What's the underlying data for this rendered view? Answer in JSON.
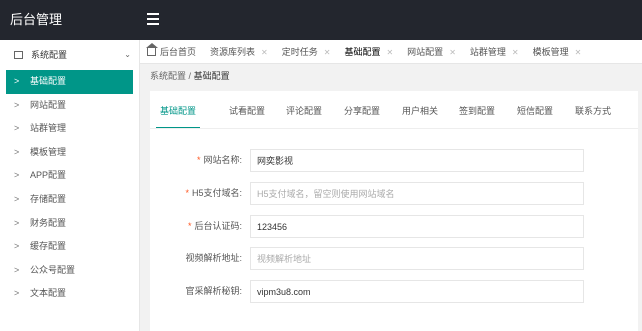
{
  "app": {
    "title": "后台管理"
  },
  "sidebar": {
    "group_label": "系统配置",
    "items": [
      {
        "label": "基础配置",
        "active": true
      },
      {
        "label": "网站配置"
      },
      {
        "label": "站群管理"
      },
      {
        "label": "模板管理"
      },
      {
        "label": "APP配置"
      },
      {
        "label": "存储配置"
      },
      {
        "label": "财务配置"
      },
      {
        "label": "缓存配置"
      },
      {
        "label": "公众号配置"
      },
      {
        "label": "文本配置"
      }
    ]
  },
  "tabs": [
    {
      "label": "后台首页",
      "closable": false
    },
    {
      "label": "资源库列表",
      "closable": true
    },
    {
      "label": "定时任务",
      "closable": true
    },
    {
      "label": "基础配置",
      "closable": true,
      "active": true
    },
    {
      "label": "网站配置",
      "closable": true
    },
    {
      "label": "站群管理",
      "closable": true
    },
    {
      "label": "模板管理",
      "closable": true
    }
  ],
  "breadcrumb": {
    "parent": "系统配置",
    "separator": "/",
    "current": "基础配置"
  },
  "subtabs": [
    {
      "label": "基础配置",
      "active": true
    },
    {
      "label": "试看配置"
    },
    {
      "label": "评论配置"
    },
    {
      "label": "分享配置"
    },
    {
      "label": "用户相关"
    },
    {
      "label": "签到配置"
    },
    {
      "label": "短信配置"
    },
    {
      "label": "联系方式"
    }
  ],
  "form": [
    {
      "label": "网站名称:",
      "required": true,
      "value": "网奕影视",
      "placeholder": ""
    },
    {
      "label": "H5支付域名:",
      "required": true,
      "value": "",
      "placeholder": "H5支付域名，留空则使用网站域名"
    },
    {
      "label": "后台认证码:",
      "required": true,
      "value": "123456",
      "placeholder": ""
    },
    {
      "label": "视频解析地址:",
      "required": false,
      "value": "",
      "placeholder": "视频解析地址"
    },
    {
      "label": "官采解析秘钥:",
      "required": false,
      "value": "vipm3u8.com",
      "placeholder": ""
    }
  ],
  "colors": {
    "accent": "#009688",
    "topbar": "#23262e",
    "required": "#ff5722"
  },
  "icons": {
    "menu": "hamburger-icon",
    "home": "home-icon",
    "group": "settings-icon",
    "close": "close-icon",
    "chevron": "chevron-down-icon",
    "arrow": "chevron-right-icon"
  }
}
